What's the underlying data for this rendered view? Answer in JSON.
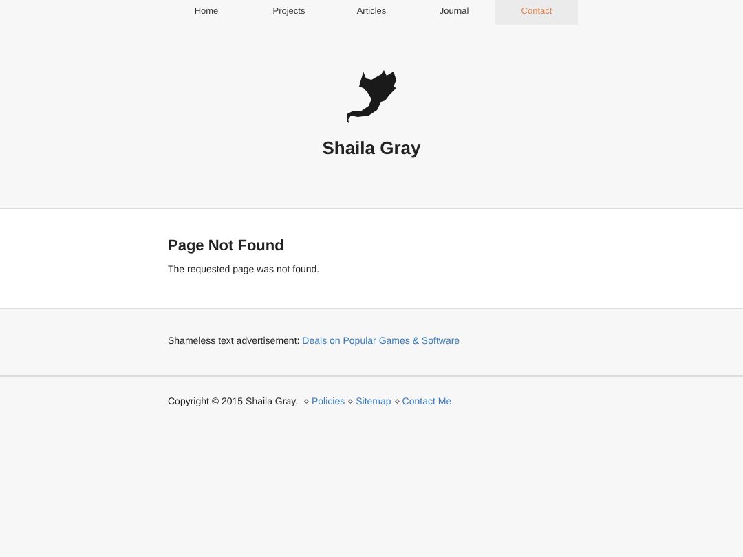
{
  "nav": [
    {
      "label": "Home",
      "selected": false
    },
    {
      "label": "Projects",
      "selected": false
    },
    {
      "label": "Articles",
      "selected": false
    },
    {
      "label": "Journal",
      "selected": false
    },
    {
      "label": "Contact",
      "selected": true
    }
  ],
  "header": {
    "title": "Shaila Gray"
  },
  "main": {
    "heading": "Page Not Found",
    "text": "The requested page was not found."
  },
  "ad": {
    "label": "Shameless text advertisement:",
    "link": "Deals on Popular Games & Software"
  },
  "footer": [
    {
      "kind": "text",
      "text": "Copyright © 2015 Shaila Gray."
    },
    {
      "kind": "separator",
      "text": "⋄"
    },
    {
      "kind": "link",
      "text": "Policies"
    },
    {
      "kind": "separator",
      "text": "⋄"
    },
    {
      "kind": "link",
      "text": "Sitemap"
    },
    {
      "kind": "separator",
      "text": "⋄"
    },
    {
      "kind": "link",
      "text": "Contact Me"
    }
  ]
}
